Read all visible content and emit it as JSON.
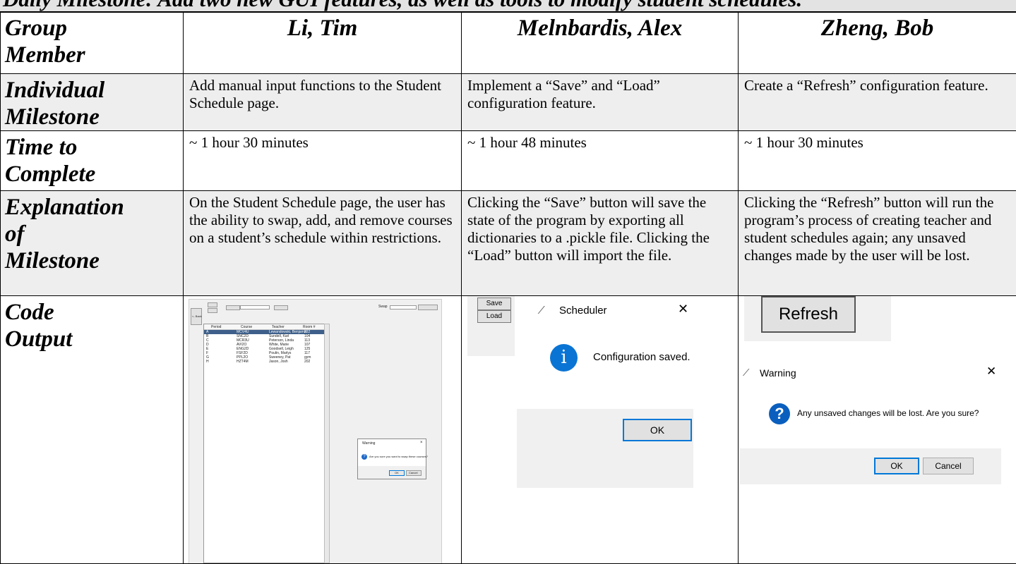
{
  "header_line": "Daily Milestone: Add two new GUI features, as well as tools to modify student schedules.",
  "table": {
    "row_labels": {
      "group_member": [
        "Group",
        "Member"
      ],
      "individual_milestone": [
        "Individual",
        "Milestone"
      ],
      "time_to_complete": [
        "Time to",
        "Complete"
      ],
      "explanation": [
        "Explanation",
        "of",
        "Milestone"
      ],
      "code_output": [
        "Code",
        "Output"
      ]
    },
    "members": [
      {
        "name": "Li, Tim",
        "milestone": "Add manual input functions to the Student Schedule page.",
        "time": "~ 1 hour 30 minutes",
        "explanation": "On the Student Schedule page, the user has the ability to swap, add, and remove courses on a student’s schedule within restrictions."
      },
      {
        "name": "Melnbardis, Alex",
        "milestone": "Implement a “Save” and “Load” configuration feature.",
        "time": "~ 1 hour 48 minutes",
        "explanation": "Clicking the “Save” button will save the state of the program by exporting all dictionaries to a .pickle file. Clicking the “Load” button will import the file."
      },
      {
        "name": "Zheng, Bob",
        "milestone": "Create a “Refresh” configuration feature.",
        "time": "~ 1 hour 30 minutes",
        "explanation": "Clicking the “Refresh” button will run the program’s process of creating teacher and student schedules again; any unsaved changes made by the user will be lost."
      }
    ]
  },
  "output_li": {
    "back_label": "<- Back",
    "swap_label": "Swap",
    "headers": [
      "Period",
      "Course",
      "Teacher",
      "Room #"
    ],
    "rows": [
      [
        "A",
        "MCV4U",
        "Lewandowski, Benjamin",
        "222"
      ],
      [
        "B",
        "SNC2D",
        "Sundell, Karl",
        "104"
      ],
      [
        "C",
        "MCR3U",
        "Peterson, Linda",
        "113"
      ],
      [
        "D",
        "AVI2O",
        "White, Marie",
        "107"
      ],
      [
        "E",
        "ENG2D",
        "Goodsell, Leigh",
        "125"
      ],
      [
        "F",
        "FSF2D",
        "Poulin, Marlys",
        "117"
      ],
      [
        "G",
        "PPL2O",
        "Sweeney, Pat",
        "gym"
      ],
      [
        "H",
        "HZT4M",
        "Jason, Josh",
        "202"
      ]
    ],
    "dialog_title": "Warning",
    "dialog_text": "Are you sure you want to swap these courses?",
    "ok": "OK",
    "cancel": "Cancel",
    "question_glyph": "?"
  },
  "output_alex": {
    "save": "Save",
    "load": "Load",
    "dialog_title": "Scheduler",
    "message": "Configuration saved.",
    "ok": "OK",
    "info_glyph": "i",
    "close_glyph": "✕",
    "feather_glyph": "⁄"
  },
  "output_bob": {
    "refresh": "Refresh",
    "dialog_title": "Warning",
    "message": "Any unsaved changes will be lost. Are you sure?",
    "ok": "OK",
    "cancel": "Cancel",
    "question_glyph": "?",
    "close_glyph": "✕",
    "feather_glyph": "⁄"
  },
  "colors": {
    "shade": "#eeeeee",
    "accent_blue": "#0078d7",
    "icon_blue": "#0a74d4"
  }
}
